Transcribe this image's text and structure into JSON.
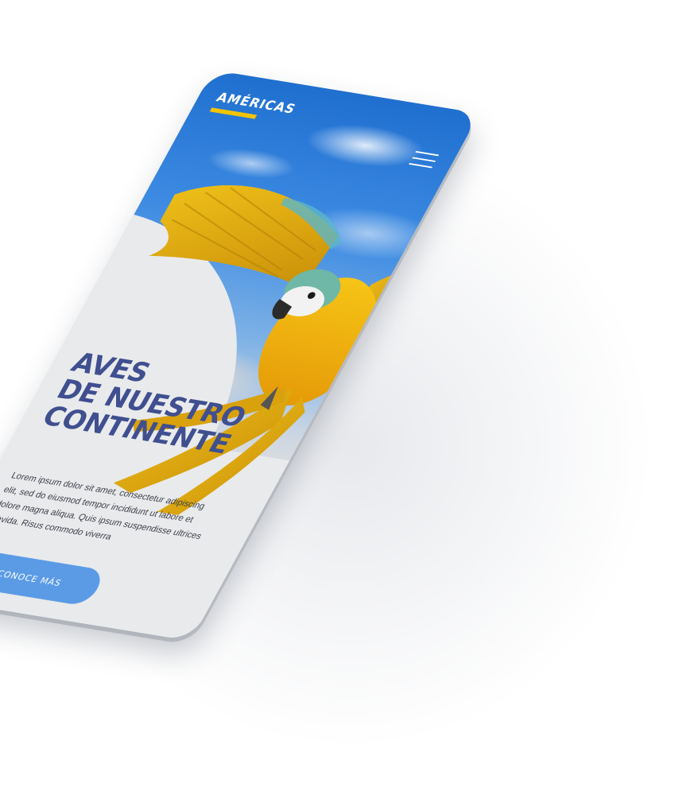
{
  "header": {
    "brand": "AMÉRICAS",
    "menu_icon": "hamburger-menu-icon"
  },
  "hero": {
    "title_lines": [
      "AVES",
      "DE NUESTRO",
      "CONTINENTE"
    ],
    "body": "Lorem ipsum dolor sit amet, consectetur adipiscing elit, sed do eiusmod tempor incididunt ut labore et dolore magna aliqua. Quis ipsum suspendisse ultrices gravida. Risus commodo viverra",
    "cta_label": "CONOCE MÁS",
    "image": "macaw-parrot-flying"
  },
  "colors": {
    "accent_yellow": "#f4c400",
    "title_blue": "#3f4f8f",
    "button_blue": "#5b9be6",
    "sky_blue": "#1f6fd0"
  }
}
